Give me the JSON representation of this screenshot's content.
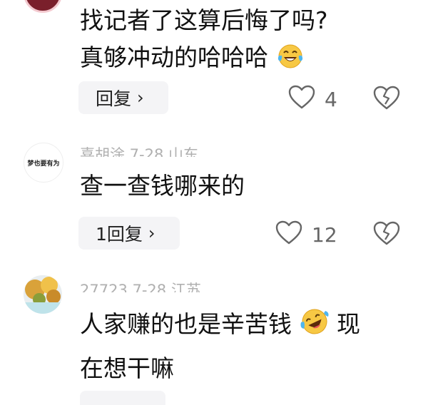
{
  "comments": [
    {
      "text_line1": "找记者了这算后悔了吗?",
      "text_line2": "真够冲动的哈哈哈",
      "emoji": "laugh-tears",
      "reply_label": "回复",
      "likes": "4"
    },
    {
      "avatar_text": "梦也要有为",
      "meta": "喜胡涂   7-28   山东",
      "text_line1": "查一查钱哪来的",
      "reply_label": "1回复",
      "likes": "12"
    },
    {
      "meta": "27723   7-28   江苏",
      "text_line1": "人家赚的也是辛苦钱",
      "emoji": "rofl",
      "text_after_emoji": "现",
      "text_line2": "在想干嘛"
    }
  ],
  "colors": {
    "text": "#111111",
    "meta": "#b0b0b0",
    "reply_bg": "#f4f4f6",
    "icon": "#666666"
  }
}
